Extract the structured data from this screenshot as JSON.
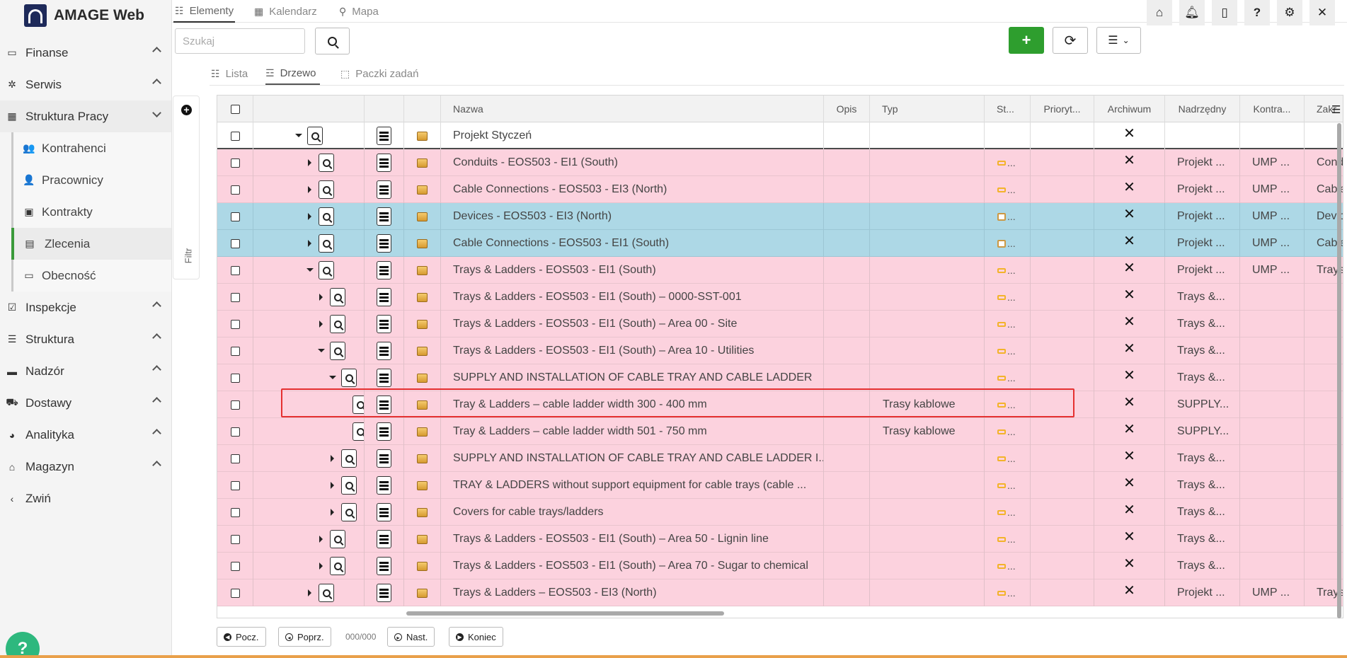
{
  "brand": {
    "name": "AMAGE Web"
  },
  "sidebar": {
    "items": [
      {
        "label": "Finanse",
        "icon": "money-icon"
      },
      {
        "label": "Serwis",
        "icon": "bug-icon"
      },
      {
        "label": "Struktura Pracy",
        "icon": "building-icon"
      },
      {
        "label": "Kontrahenci",
        "icon": "users-icon"
      },
      {
        "label": "Pracownicy",
        "icon": "user-tie-icon"
      },
      {
        "label": "Kontrakty",
        "icon": "money-bill-icon"
      },
      {
        "label": "Zlecenia",
        "icon": "clipboard-icon"
      },
      {
        "label": "Obecność",
        "icon": "id-card-icon"
      },
      {
        "label": "Inspekcje",
        "icon": "check-square-icon"
      },
      {
        "label": "Struktura",
        "icon": "sitemap-icon"
      },
      {
        "label": "Nadzór",
        "icon": "eye-icon"
      },
      {
        "label": "Dostawy",
        "icon": "truck-icon"
      },
      {
        "label": "Analityka",
        "icon": "chart-icon"
      },
      {
        "label": "Magazyn",
        "icon": "warehouse-icon"
      },
      {
        "label": "Zwiń",
        "icon": "chevron-left-icon"
      }
    ]
  },
  "filter": {
    "label": "Filtr"
  },
  "tabs": [
    "Elementy",
    "Kalendarz",
    "Mapa"
  ],
  "search": {
    "placeholder": "Szukaj"
  },
  "view_tabs": [
    "Lista",
    "Drzewo",
    "Paczki zadań"
  ],
  "grid": {
    "columns": [
      "Nazwa",
      "Opis",
      "Typ",
      "St...",
      "Prioryt...",
      "Archiwum",
      "Nadrzędny",
      "Kontra...",
      "Zakr"
    ],
    "rows": [
      {
        "name": "Projekt Styczeń",
        "typ": "",
        "st": "",
        "archiwum": "✕",
        "nadrzedny": "",
        "kontra": "",
        "zakr": ""
      },
      {
        "name": "Conduits - EOS503 - EI1 (South)",
        "typ": "",
        "st": "...",
        "archiwum": "✕",
        "nadrzedny": "Projekt ...",
        "kontra": "UMP ...",
        "zakr": "Cond"
      },
      {
        "name": "Cable Connections - EOS503 - EI3 (North)",
        "typ": "",
        "st": "...",
        "archiwum": "✕",
        "nadrzedny": "Projekt ...",
        "kontra": "UMP ...",
        "zakr": "Cable"
      },
      {
        "name": "Devices - EOS503 - EI3 (North)",
        "typ": "",
        "st": "...",
        "archiwum": "✕",
        "nadrzedny": "Projekt ...",
        "kontra": "UMP ...",
        "zakr": "Devic"
      },
      {
        "name": "Cable Connections - EOS503 - EI1 (South)",
        "typ": "",
        "st": "...",
        "archiwum": "✕",
        "nadrzedny": "Projekt ...",
        "kontra": "UMP ...",
        "zakr": "Cable"
      },
      {
        "name": "Trays & Ladders - EOS503 - EI1 (South)",
        "typ": "",
        "st": "...",
        "archiwum": "✕",
        "nadrzedny": "Projekt ...",
        "kontra": "UMP ...",
        "zakr": "Trays"
      },
      {
        "name": "Trays & Ladders - EOS503 - EI1 (South) – 0000-SST-001",
        "typ": "",
        "st": "...",
        "archiwum": "✕",
        "nadrzedny": "Trays &...",
        "kontra": "",
        "zakr": ""
      },
      {
        "name": "Trays & Ladders - EOS503 - EI1 (South) – Area 00 - Site",
        "typ": "",
        "st": "...",
        "archiwum": "✕",
        "nadrzedny": "Trays &...",
        "kontra": "",
        "zakr": ""
      },
      {
        "name": "Trays & Ladders - EOS503 - EI1 (South) – Area 10 - Utilities",
        "typ": "",
        "st": "...",
        "archiwum": "✕",
        "nadrzedny": "Trays &...",
        "kontra": "",
        "zakr": ""
      },
      {
        "name": "SUPPLY AND INSTALLATION OF CABLE TRAY AND CABLE LADDER",
        "typ": "",
        "st": "...",
        "archiwum": "✕",
        "nadrzedny": "Trays &...",
        "kontra": "",
        "zakr": ""
      },
      {
        "name": "Tray & Ladders – cable ladder width 300 - 400 mm",
        "typ": "Trasy kablowe",
        "st": "...",
        "archiwum": "✕",
        "nadrzedny": "SUPPLY...",
        "kontra": "",
        "zakr": ""
      },
      {
        "name": "Tray & Ladders – cable ladder width 501 - 750 mm",
        "typ": "Trasy kablowe",
        "st": "...",
        "archiwum": "✕",
        "nadrzedny": "SUPPLY...",
        "kontra": "",
        "zakr": ""
      },
      {
        "name": "SUPPLY AND INSTALLATION OF CABLE TRAY AND CABLE LADDER I...",
        "typ": "",
        "st": "...",
        "archiwum": "✕",
        "nadrzedny": "Trays &...",
        "kontra": "",
        "zakr": ""
      },
      {
        "name": "TRAY & LADDERS without support equipment for cable trays (cable ...",
        "typ": "",
        "st": "...",
        "archiwum": "✕",
        "nadrzedny": "Trays &...",
        "kontra": "",
        "zakr": ""
      },
      {
        "name": "Covers for cable trays/ladders",
        "typ": "",
        "st": "...",
        "archiwum": "✕",
        "nadrzedny": "Trays &...",
        "kontra": "",
        "zakr": ""
      },
      {
        "name": "Trays & Ladders - EOS503 - EI1 (South) – Area 50 - Lignin line",
        "typ": "",
        "st": "...",
        "archiwum": "✕",
        "nadrzedny": "Trays &...",
        "kontra": "",
        "zakr": ""
      },
      {
        "name": "Trays & Ladders - EOS503 - EI1 (South) – Area 70 - Sugar to chemical",
        "typ": "",
        "st": "...",
        "archiwum": "✕",
        "nadrzedny": "Trays &...",
        "kontra": "",
        "zakr": ""
      },
      {
        "name": "Trays & Ladders – EOS503 - EI3 (North)",
        "typ": "",
        "st": "...",
        "archiwum": "✕",
        "nadrzedny": "Projekt ...",
        "kontra": "UMP ...",
        "zakr": "Trays"
      }
    ]
  },
  "pager": {
    "first": "Pocz.",
    "prev": "Poprz.",
    "count": "000/000",
    "next": "Nast.",
    "last": "Koniec"
  },
  "help": {
    "label": "?"
  },
  "colors": {
    "row_pink": "#fcd2de",
    "row_blue": "#add8e6",
    "add_green": "#2e9e2e",
    "active_green": "#3a9a3a",
    "highlight_red": "#e53030"
  }
}
